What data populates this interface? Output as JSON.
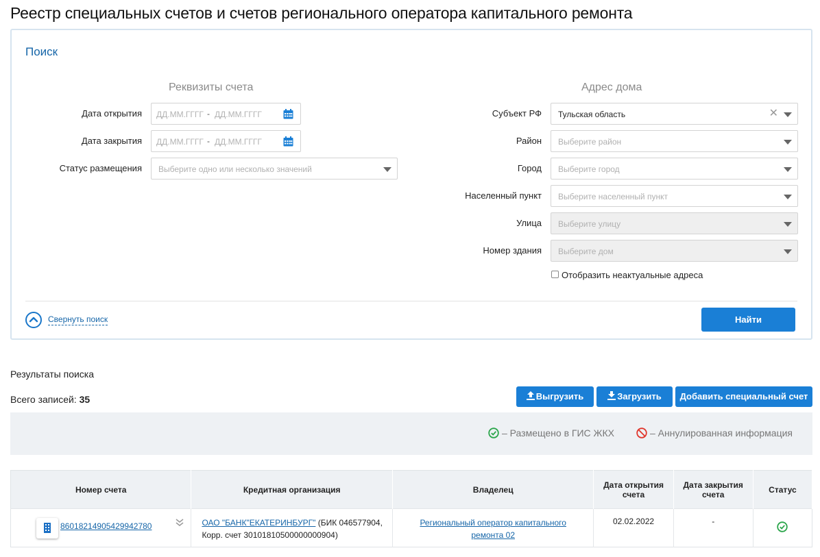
{
  "page": {
    "title": "Реестр специальных счетов и счетов регионального оператора капитального ремонта"
  },
  "search": {
    "heading": "Поиск",
    "account_section": {
      "title": "Реквизиты счета",
      "open_date": {
        "label": "Дата открытия",
        "from_placeholder": "ДД.ММ.ГГГГ",
        "separator": "-",
        "to_placeholder": "ДД.ММ.ГГГГ"
      },
      "close_date": {
        "label": "Дата закрытия",
        "from_placeholder": "ДД.ММ.ГГГГ",
        "separator": "-",
        "to_placeholder": "ДД.ММ.ГГГГ"
      },
      "status": {
        "label": "Статус размещения",
        "placeholder": "Выберите одно или несколько значений"
      }
    },
    "address_section": {
      "title": "Адрес дома",
      "region": {
        "label": "Субъект РФ",
        "value": "Тульская область"
      },
      "district": {
        "label": "Район",
        "placeholder": "Выберите район"
      },
      "city": {
        "label": "Город",
        "placeholder": "Выберите город"
      },
      "settlement": {
        "label": "Населенный пункт",
        "placeholder": "Выберите населенный пункт"
      },
      "street": {
        "label": "Улица",
        "placeholder": "Выберите улицу"
      },
      "building": {
        "label": "Номер здания",
        "placeholder": "Выберите дом"
      },
      "show_inactive": {
        "label": "Отобразить неактуальные адреса",
        "checked": false
      }
    },
    "collapse_label": "Свернуть поиск",
    "find_button": "Найти"
  },
  "results": {
    "label": "Результаты поиска",
    "total_prefix": "Всего записей:",
    "total_count": "35",
    "export_button": "Выгрузить",
    "import_button": "Загрузить",
    "add_button": "Добавить специальный счет",
    "legend": {
      "placed": "–  Размещено в ГИС ЖКХ",
      "cancelled": "–  Аннулированная информация"
    },
    "columns": [
      "Номер счета",
      "Кредитная организация",
      "Владелец",
      "Дата открытия счета",
      "Дата закрытия счета",
      "Статус"
    ],
    "rows": [
      {
        "account_number": "86018214905429942780",
        "bank_link": "ОАО \"БАНК\"ЕКАТЕРИНБУРГ\"",
        "bank_details": " (БИК 046577904, Корр. счет 30101810500000000904)",
        "owner": "Региональный оператор капитального ремонта 02",
        "open_date": "02.02.2022",
        "close_date": "-",
        "status": "placed"
      }
    ]
  },
  "colors": {
    "accent": "#1a7fd6",
    "link": "#1565a8",
    "success": "#2aa54a",
    "danger": "#e0352b"
  }
}
